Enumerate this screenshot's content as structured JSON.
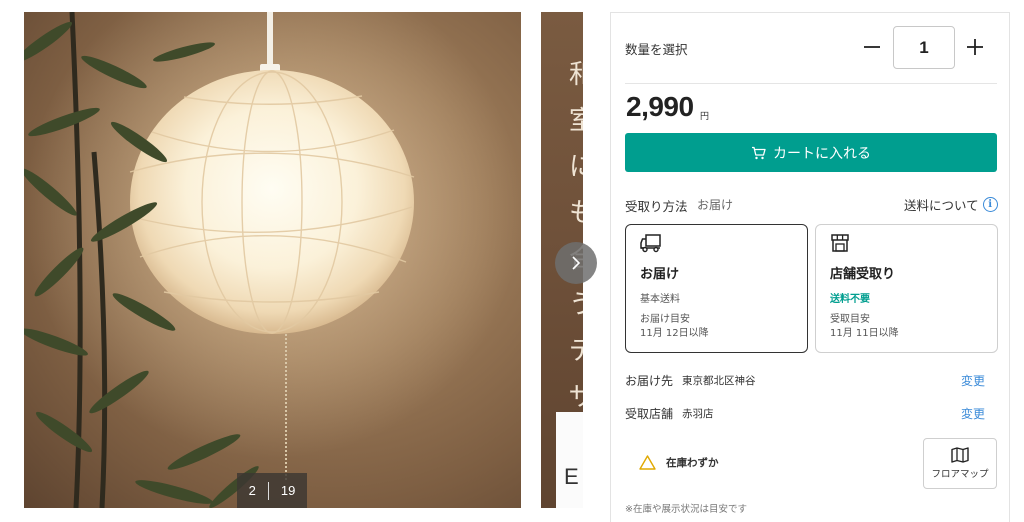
{
  "gallery": {
    "current_index": "2",
    "total": "19",
    "next_image_text": "和室にも合うデザイン",
    "next_image_card_text": "E"
  },
  "quantity": {
    "label": "数量を選択",
    "value": "1"
  },
  "price": {
    "amount": "2,990",
    "currency": "円"
  },
  "cart_button": {
    "label": "カートに入れる"
  },
  "receive": {
    "label": "受取り方法",
    "selected": "お届け",
    "shipping_info_link": "送料について"
  },
  "options": [
    {
      "title": "お届け",
      "fee": "基本送料",
      "eta_label": "お届け目安",
      "eta": "11月 12日以降",
      "selected": true,
      "icon": "truck-icon"
    },
    {
      "title": "店舗受取り",
      "fee": "送料不要",
      "eta_label": "受取目安",
      "eta": "11月 11日以降",
      "selected": false,
      "icon": "store-icon"
    }
  ],
  "destination": {
    "label": "お届け先",
    "value": "東京都北区神谷",
    "change_link": "変更"
  },
  "store": {
    "label": "受取店舗",
    "value": "赤羽店",
    "change_link": "変更"
  },
  "stock": {
    "status": "在庫わずか",
    "icon": "warning-icon"
  },
  "floor_map": {
    "label": "フロアマップ",
    "icon": "map-icon"
  },
  "note": "※在庫や展示状況は目安です",
  "colors": {
    "accent": "#009e8f",
    "link": "#3a8ad8",
    "warning": "#e0a800"
  }
}
